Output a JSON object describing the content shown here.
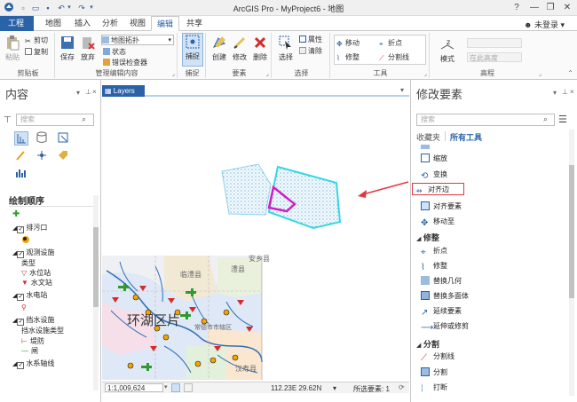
{
  "titlebar": {
    "title": "ArcGIS Pro - MyProject6 - 地图",
    "help": "?",
    "minimize": "—",
    "restore": "❐",
    "close": "✕",
    "user": "未登录",
    "user_caret": "▾"
  },
  "tabs": [
    "工程",
    "地图",
    "插入",
    "分析",
    "视图",
    "编辑",
    "共享"
  ],
  "active_tab": "编辑",
  "ribbon": {
    "clipboard": {
      "label": "剪贴板",
      "paste": "粘贴",
      "cut": "剪切",
      "copy": "复制"
    },
    "manage": {
      "label": "管理编辑内容",
      "save": "保存",
      "discard": "放弃",
      "topology": "地图拓扑",
      "status": "状态",
      "error_inspector": "错误检查器"
    },
    "snapping": {
      "label": "捕捉",
      "snap": "捕捉"
    },
    "features": {
      "label": "要素",
      "create": "创建",
      "modify": "修改",
      "delete": "删除"
    },
    "selection": {
      "label": "选择",
      "select": "选择",
      "attributes": "属性",
      "clear": "清除"
    },
    "tools": {
      "label": "工具",
      "move": "移动",
      "vertex": "折点",
      "reshape": "修整",
      "split": "分割线"
    },
    "elevation": {
      "label": "高程",
      "mode": "模式",
      "field": "在此高度"
    }
  },
  "contents": {
    "title": "内容",
    "search_placeholder": "搜索",
    "draw_order": "绘制顺序",
    "layers": [
      {
        "name": "排污口",
        "checked": true
      },
      {
        "name": "观测设施",
        "checked": true
      },
      {
        "name": "类型",
        "checked": false
      },
      {
        "name": "水位站",
        "checked": false
      },
      {
        "name": "水文站",
        "checked": false
      },
      {
        "name": "水电站",
        "checked": true
      },
      {
        "name": "挡水设施",
        "checked": true
      },
      {
        "name": "挡水设施类型",
        "checked": false
      },
      {
        "name": "堤防",
        "checked": false
      },
      {
        "name": "闸",
        "checked": false
      },
      {
        "name": "水系轴线",
        "checked": true
      }
    ]
  },
  "map": {
    "tab_label": "Layers",
    "tab_close": "×",
    "scale": "1:1,009,624",
    "coords": "112.23E 29.62N",
    "selected": "所选要素: 1",
    "labels": [
      "环湖区片",
      "临澧县",
      "澧县",
      "安乡县",
      "常德市市辖区",
      "汉寿县"
    ]
  },
  "modify": {
    "title": "修改要素",
    "search_placeholder": "搜索",
    "tab_favorites": "收藏夹",
    "tab_all": "所有工具",
    "tools_top": [
      "缩放",
      "变换",
      "对齐边",
      "对齐要素",
      "移动至"
    ],
    "cat_reshape": "修整",
    "tools_reshape": [
      "折点",
      "修整",
      "替换几何",
      "替换多面体",
      "延续要素",
      "延伸或修剪"
    ],
    "cat_split": "分割",
    "tools_split": [
      "分割线",
      "分割",
      "打断"
    ]
  },
  "colors": {
    "accent": "#2a62a8",
    "highlight": "#e0393e",
    "polygon_cyan": "#36d6e6",
    "polygon_magenta": "#d11fc8"
  }
}
